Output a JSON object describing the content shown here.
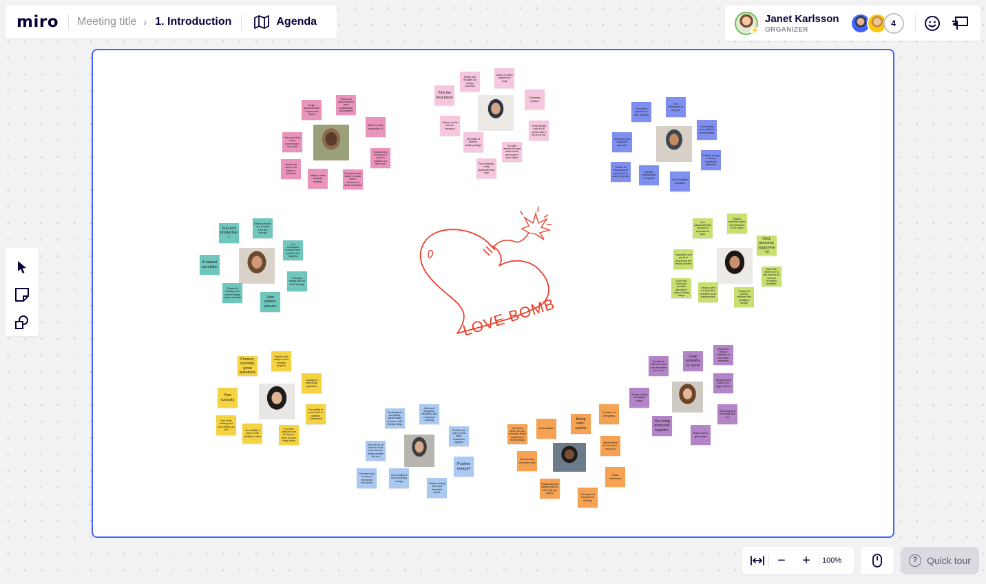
{
  "topbar": {
    "logo": "miro",
    "breadcrumb_board": "Meeting title",
    "breadcrumb_arrow": "›",
    "breadcrumb_current": "1. Introduction",
    "agenda_label": "Agenda",
    "agenda_icon": "map-icon"
  },
  "user": {
    "name": "Janet Karlsson",
    "role": "ORGANIZER",
    "collaborator_count": "4"
  },
  "actions": {
    "reactions_icon": "smiley-icon",
    "presentation_icon": "presentation-icon"
  },
  "toolbar": {
    "tools": [
      "select-icon",
      "sticky-note-icon",
      "shapes-icon"
    ]
  },
  "zoom": {
    "fit_icon": "fit-width-icon",
    "minus": "−",
    "plus": "+",
    "value": "100%"
  },
  "quick_tour": {
    "icon": "?",
    "label": "Quick tour"
  },
  "center_art": {
    "text": "LOVE BOMB",
    "color": "#e8402b"
  },
  "colors": {
    "accent": "#4262ff",
    "frame_border": "#4262ff"
  },
  "clusters": {
    "pink": [
      "Tough questions that support and clarify",
      "Thanks for advocating for team collaboration and delivery",
      "Share, honest, supportive <3",
      "Empowering the team to come to solutions on their own",
      "Compassionate leader to make BOLD decisions in these moments",
      "Ability to drive strategic thinking",
      "Candid and open to all types of feedback",
      "How you bring every conversation up a level"
    ],
    "pale": [
      "Tells the best jokes",
      "Really well thought-out design concepts",
      "Jumps in when needed the most",
      "Extremely creative",
      "Great design work but it comes with a bit of fun too",
      "You take already thought about items and make it even better",
      "Incredible at intuition-leading design",
      "Fun & friendly, really appreciate that man",
      "Always on the look for feedback"
    ],
    "blue": [
      "Thoughtful approach to user journeys",
      "Your willingness to say yes",
      "Great design work, patience with feedback",
      "Positive energy & always looking for alignment",
      "Your thoughtful questions",
      "Humble, professional, thoughtful",
      "Thanks for bringing your whole self to work every day",
      "Structured and organized approach"
    ],
    "green": [
      "Your passionate and structured approach to work",
      "Raises essential topics and decisions to be made",
      "Kind, personal, supportive <3",
      "Work with heart: love to see why you're such an excellent facilitator",
      "Thanks for putting structure into ambitious design",
      "Always open for input and inclusive to all perspectives",
      "Love how much you prioritize alternative ways of doing things",
      "Supportive and great at structuring the design process"
    ],
    "teal": [
      "Fun and productive!",
      "Dancing breaks are a must! Love the energy!",
      "Your contagious energy: fresh, positive and inspiring",
      "How you always find the best analogy",
      "How patient you are",
      "Thanks for setting up for several design sprints already!",
      "A natural storyteller"
    ],
    "yellow": [
      "Passion, curiosity, great questions",
      "Passion and ability to drive complex projects",
      "Courage to raise tough questions",
      "Your ability to push back or question \"consensus\"",
      "You have: pleasure and the team's drive for your sharp ideas",
      "Your ability to jump in and facilitate in labs",
      "Your deep thinking and how daring you are",
      "Your curiosity"
    ],
    "light": [
      "Great taste in everything, great design process, solid human being",
      "Calm and thoughtful, iterations with continuous learning",
      "Positive and open to new ideas, brainstorm together",
      "Positive energy!!",
      "Always seeing deep and important points",
      "Your creative & mood-building energy",
      "The team lead to ensure everybody feels good",
      "You can do so much in short time and see things outside the box"
    ],
    "orange": [
      "The times when you put everyone at the beginning of the meetings",
      "Personalities",
      "Being user-centric",
      "A master at delegating",
      "Always there for me when I need you",
      "Great interviewer",
      "You say what everyone is thinking",
      "Passionate and always ready to dive into any project",
      "Representing customer voice"
    ],
    "purple": [
      "Quotations: That's the word that describes your work",
      "Deep empathy to users",
      "Thanks for being a champion of new team members",
      "Always going back to the bigger picture",
      "Encouraging & new folks (like me)",
      "Brave, with a good heart",
      "You bring everyone together",
      "Always raising the difficult points"
    ]
  }
}
